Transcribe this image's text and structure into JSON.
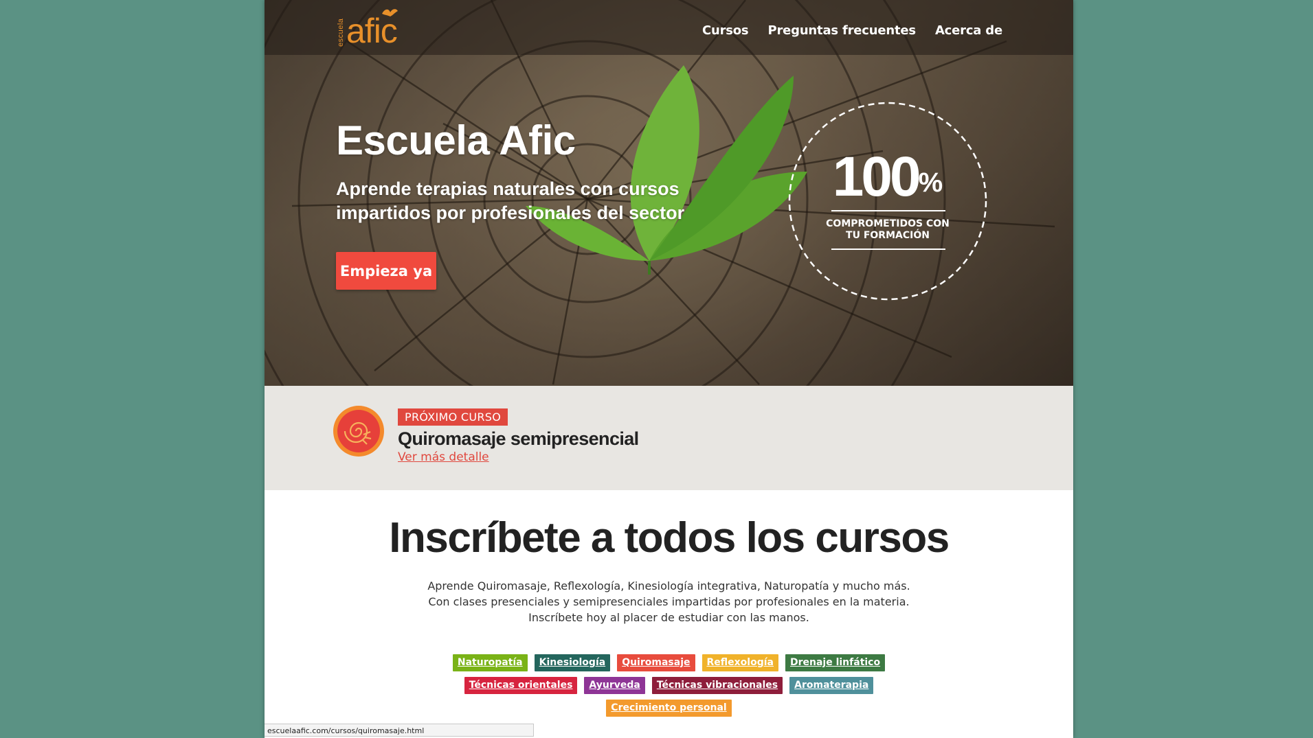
{
  "header": {
    "logo_small": "escuela",
    "logo_main": "afic",
    "nav": [
      {
        "label": "Cursos"
      },
      {
        "label": "Preguntas frecuentes"
      },
      {
        "label": "Acerca de"
      }
    ]
  },
  "hero": {
    "title": "Escuela Afic",
    "subtitle": "Aprende terapias naturales con cursos impartidos por profesionales del sector",
    "cta_label": "Empieza ya",
    "badge": {
      "number": "100",
      "percent": "%",
      "line1": "COMPROMETIDOS CON",
      "line2": "TU FORMACIÓN"
    }
  },
  "next_course": {
    "tag": "PRÓXIMO CURSO",
    "title": "Quiromasaje semipresencial",
    "link": "Ver más detalle"
  },
  "enroll": {
    "title": "Inscríbete a todos los cursos",
    "lines": [
      "Aprende Quiromasaje, Reflexología, Kinesiología integrativa, Naturopatía y mucho más.",
      "Con clases presenciales y semipresenciales impartidas por profesionales en la materia.",
      "Inscríbete hoy al placer de estudiar con las manos."
    ],
    "tag_rows": [
      [
        {
          "label": "Naturopatía",
          "color": "#7ab317"
        },
        {
          "label": "Kinesiología",
          "color": "#24665d"
        },
        {
          "label": "Quiromasaje",
          "color": "#e84c3d"
        },
        {
          "label": "Reflexología",
          "color": "#f0b22a"
        },
        {
          "label": "Drenaje linfático",
          "color": "#3d7a43"
        }
      ],
      [
        {
          "label": "Técnicas orientales",
          "color": "#d7243f"
        },
        {
          "label": "Ayurveda",
          "color": "#8e3596"
        },
        {
          "label": "Técnicas vibracionales",
          "color": "#8e1e3b"
        },
        {
          "label": "Aromaterapia",
          "color": "#4f909b"
        }
      ],
      [
        {
          "label": "Crecimiento personal",
          "color": "#f39a2d"
        }
      ]
    ]
  },
  "status_bar": {
    "url": "escuelaafic.com/cursos/quiromasaje.html"
  },
  "colors": {
    "accent": "#f04a3e",
    "logo": "#e8902a",
    "background": "#5b9284"
  }
}
